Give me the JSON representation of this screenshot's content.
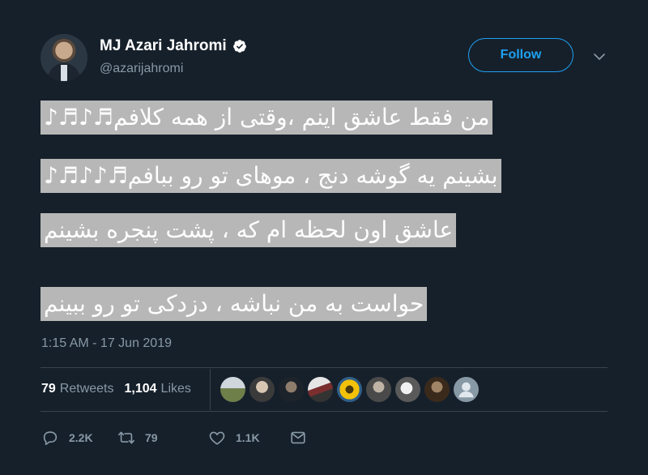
{
  "author": {
    "display_name": "MJ Azari Jahromi",
    "handle": "@azarijahromi",
    "verified": true
  },
  "follow_button": {
    "label": "Follow"
  },
  "tweet": {
    "lines": [
      "من فقط عاشق اینم ،وقتی از همه کلافم♬♪♬♪",
      "بشینم یه گوشه دنج ، موهای تو رو ببافم♬♪♪♬♪",
      "عاشق اون لحظه ام که ، پشت پنجره بشینم",
      "حواست به من نباشه ، دزدکی تو رو ببینم"
    ],
    "highlight_color": "#b7b7b7",
    "timestamp": "1:15 AM - 17 Jun 2019"
  },
  "stats": {
    "retweets_count": "79",
    "retweets_label": "Retweets",
    "likes_count": "1,104",
    "likes_label": "Likes"
  },
  "likers": [
    {
      "name": "liker-avatar-1"
    },
    {
      "name": "liker-avatar-2"
    },
    {
      "name": "liker-avatar-3"
    },
    {
      "name": "liker-avatar-4"
    },
    {
      "name": "liker-avatar-5"
    },
    {
      "name": "liker-avatar-6"
    },
    {
      "name": "liker-avatar-7"
    },
    {
      "name": "liker-avatar-8"
    },
    {
      "name": "liker-avatar-9"
    }
  ],
  "actions": {
    "reply_count": "2.2K",
    "retweet_count": "79",
    "like_count": "1.1K"
  },
  "colors": {
    "background": "#16202b",
    "accent": "#1da1f2",
    "muted_text": "#8899a6",
    "divider": "#38444d"
  }
}
